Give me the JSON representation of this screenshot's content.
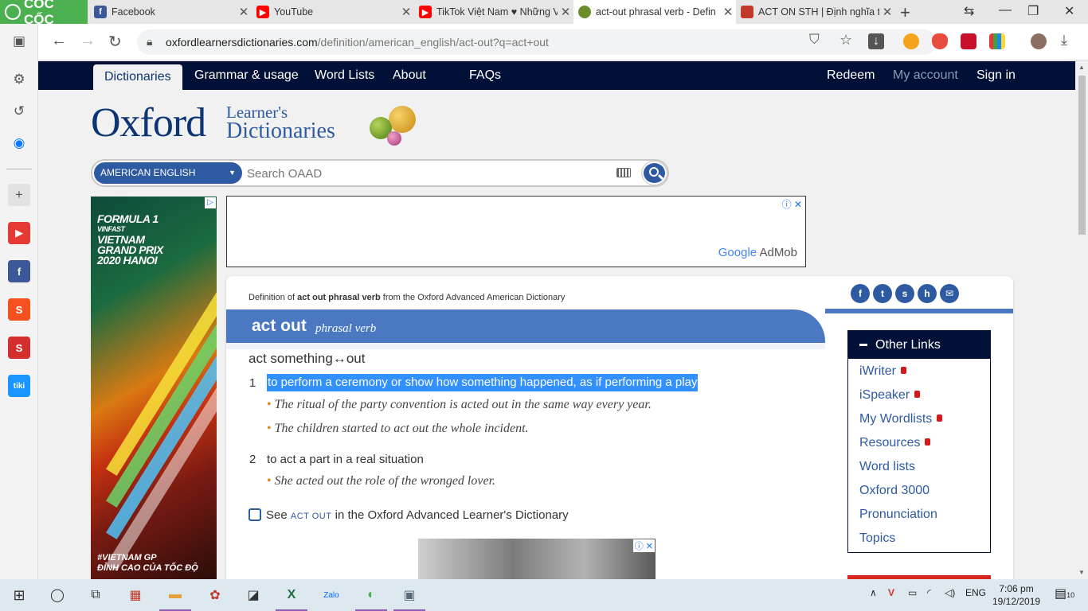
{
  "browser": {
    "brand": "CỐC CỐC",
    "tabs": [
      {
        "title": "Facebook",
        "icon": "facebook-icon",
        "color": "#3b5998"
      },
      {
        "title": "YouTube",
        "icon": "youtube-icon",
        "color": "#ff0000"
      },
      {
        "title": "TikTok Việt Nam ♥ Những V",
        "icon": "youtube-icon",
        "color": "#ff0000"
      },
      {
        "title": "act-out phrasal verb - Defin",
        "icon": "oxford-balls-icon",
        "color": "#6a8f2a"
      },
      {
        "title": "ACT ON STH | Định nghĩa tr",
        "icon": "cambridge-icon",
        "color": "#c0392b"
      }
    ],
    "url_host": "oxfordlearnersdictionaries.com",
    "url_path": "/definition/american_english/act-out?q=act+out"
  },
  "nav": {
    "dictionaries": "Dictionaries",
    "grammar": "Grammar & usage",
    "word_lists": "Word Lists",
    "about": "About",
    "faqs": "FAQs",
    "redeem": "Redeem",
    "my_account": "My account",
    "sign_in": "Sign in"
  },
  "logo": {
    "oxford": "Oxford",
    "learners": "Learner's",
    "dictionaries": "Dictionaries"
  },
  "search": {
    "dictionary": "AMERICAN ENGLISH",
    "placeholder": "Search OAAD"
  },
  "ads": {
    "sky_title": "FORMULA 1 VINFAST VIETNAM GRAND PRIX 2020 HANOI",
    "sky_lines": [
      "FORMULA 1",
      "VINFAST",
      "VIETNAM",
      "GRAND PRIX",
      "2020 HANOI"
    ],
    "sky_bottom_1": "#VIETNAM GP",
    "sky_bottom_2": "ĐỈNH CAO CỦA TỐC ĐỘ",
    "banner_brand_google": "Google",
    "banner_brand_admob": "AdMob"
  },
  "entry": {
    "source_prefix": "Definition of ",
    "source_term": "act out phrasal verb",
    "source_suffix": " from the Oxford Advanced American Dictionary",
    "headword": "act out",
    "pos": "phrasal verb",
    "idiom": "act something↔out",
    "senses": [
      {
        "num": "1",
        "definition": "to perform a ceremony or show how something happened, as if performing a play",
        "examples": [
          "The ritual of the party convention is acted out in the same way every year.",
          "The children started to act out the whole incident."
        ]
      },
      {
        "num": "2",
        "definition": "to act a part in a real situation",
        "examples": [
          "She acted out the role of the wronged lover."
        ]
      }
    ],
    "see_prefix": "See ",
    "see_term": "ACT OUT",
    "see_suffix": " in the Oxford Advanced Learner's Dictionary"
  },
  "other_links": {
    "title": "Other Links",
    "items": [
      "iWriter",
      "iSpeaker",
      "My Wordlists",
      "Resources",
      "Word lists",
      "Oxford 3000",
      "Pronunciation",
      "Topics"
    ]
  },
  "taskbar": {
    "language": "ENG",
    "time": "7:06 pm",
    "date": "19/12/2019",
    "notifications": "10"
  },
  "colors": {
    "navy": "#001036",
    "blue": "#4a78c1",
    "brand_green": "#4caf50"
  }
}
